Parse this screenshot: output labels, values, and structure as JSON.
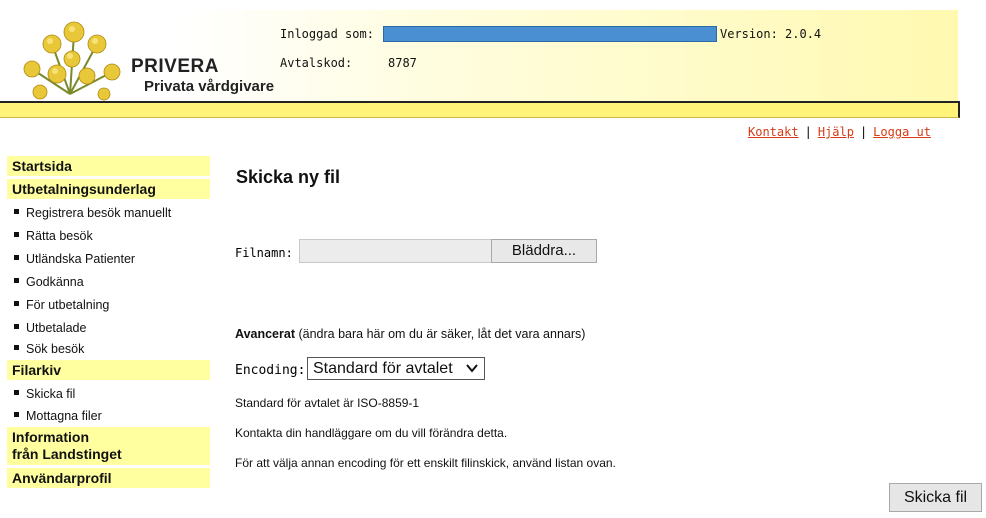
{
  "header": {
    "brand_name": "PRIVERA",
    "brand_sub": "Privata vårdgivare",
    "login_label": "Inloggad som:",
    "version_label": "Version: 2.0.4",
    "agreement_label": "Avtalskod:",
    "agreement_value": "8787"
  },
  "top_links": {
    "contact": "Kontakt",
    "help": "Hjälp",
    "logout": "Logga ut"
  },
  "sidebar": {
    "home": "Startsida",
    "payment_head": "Utbetalningsunderlag",
    "payment_items": [
      "Registrera besök manuellt",
      "Rätta besök",
      "Utländska Patienter",
      "Godkänna",
      "För utbetalning",
      "Utbetalade",
      "Sök besök"
    ],
    "archive_head": "Filarkiv",
    "archive_items": [
      "Skicka fil",
      "Mottagna filer"
    ],
    "info_head_line1": "Information",
    "info_head_line2": "från Landstinget",
    "profile_head": "Användarprofil"
  },
  "main": {
    "title": "Skicka ny fil",
    "file_label": "Filnamn:",
    "browse_label": "Bläddra...",
    "advanced_bold": "Avancerat",
    "advanced_rest": " (ändra bara här om du är säker, låt det vara annars)",
    "encoding_label": "Encoding:",
    "encoding_selected": "Standard för avtalet",
    "note1": "Standard för avtalet är ISO-8859-1",
    "note2": "Kontakta din handläggare om du vill förändra detta.",
    "note3": "För att välja annan encoding för ett enskilt filinskick, använd listan ovan.",
    "send_label": "Skicka fil"
  },
  "colors": {
    "header_bar": "#fff37a",
    "nav_head_bg": "#ffffa0",
    "link": "#d63b16",
    "login_bar": "#4a8fd1"
  }
}
